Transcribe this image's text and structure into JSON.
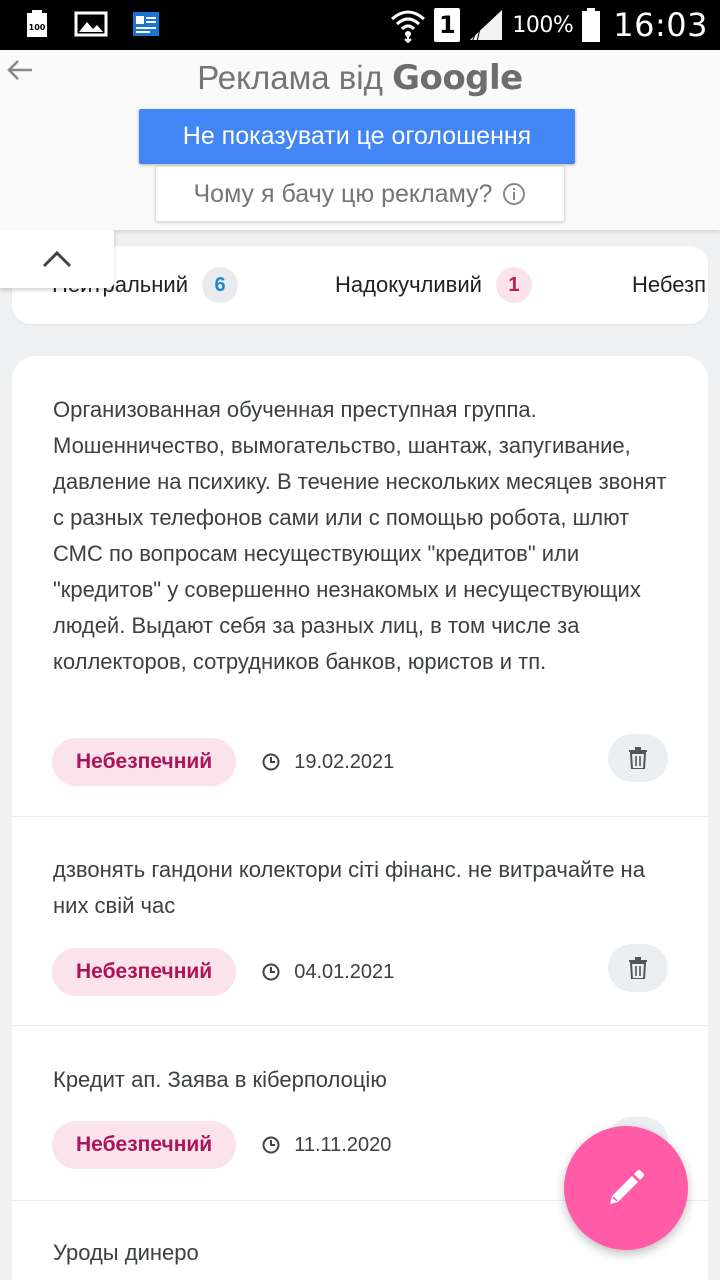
{
  "status_bar": {
    "battery_percent": "100%",
    "time": "16:03",
    "sim_slot": "1",
    "notification_icons": [
      "battery-saver-100-icon",
      "gallery-icon",
      "contact-card-icon"
    ]
  },
  "ad": {
    "title_prefix": "Реклама від ",
    "title_brand": "Google",
    "hide_button": "Не показувати це оголошення",
    "why_button": "Чому я бачу цю рекламу?"
  },
  "tabs": [
    {
      "label": "Нейтральний",
      "count": "6"
    },
    {
      "label": "Надокучливий",
      "count": "1"
    },
    {
      "label": "Небезп"
    }
  ],
  "comments": [
    {
      "text": "Организованная обученная преступная группа. Мошенничество, вымогательство, шантаж, запугивание, давление на психику. В течение нескольких месяцев звонят с разных телефонов сами или с помощью робота, шлют СМС по вопросам несуществующих \"кредитов\" или \"кредитов\" у совершенно незнакомых и несуществующих людей. Выдают себя за разных лиц, в том числе за коллекторов, сотрудников банков, юристов и тп.",
      "badge": "Небезпечний",
      "date": "19.02.2021"
    },
    {
      "text": "дзвонять гандони колектори сіті фінанс. не витрачайте на них свій час",
      "badge": "Небезпечний",
      "date": "04.01.2021"
    },
    {
      "text": "Кредит ап. Заява в кіберполоцію",
      "badge": "Небезпечний",
      "date": "11.11.2020"
    },
    {
      "text": "Уроды динеро"
    }
  ],
  "colors": {
    "ad_button_blue": "#4285f4",
    "danger_badge_bg": "#fbe3ec",
    "danger_badge_text": "#ad1457",
    "fab_pink": "#ff5ba6",
    "neutral_count_text": "#1e88c8"
  }
}
